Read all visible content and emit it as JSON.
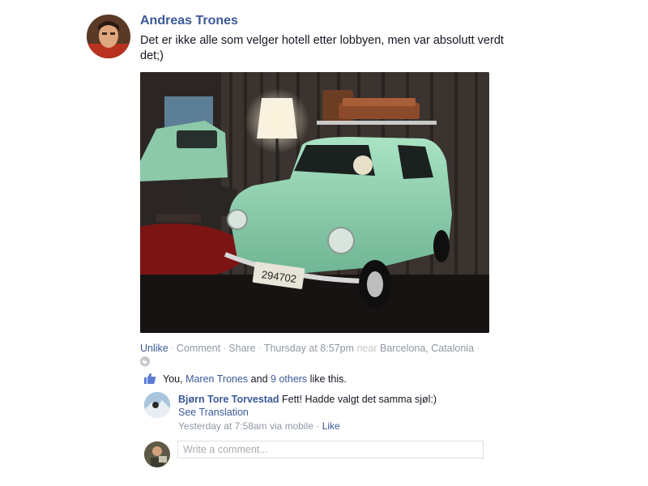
{
  "post": {
    "author": "Andreas Trones",
    "text": "Det er ikke alle som velger hotell etter lobbyen, men var absolutt verdt det;)",
    "photo_plate": "294702"
  },
  "actions": {
    "unlike": "Unlike",
    "comment": "Comment",
    "share": "Share",
    "timestamp": "Thursday at 8:57pm",
    "near": "near",
    "location": "Barcelona, Catalonia",
    "separator": "·"
  },
  "likes": {
    "prefix": "You,",
    "person": "Maren Trones",
    "and": "and",
    "others": "9 others",
    "suffix": "like this."
  },
  "comment": {
    "author": "Bjørn Tore Torvestad",
    "text": "Fett! Hadde valgt det samma sjøl:)",
    "see_translation": "See Translation",
    "meta": "Yesterday at 7:58am via mobile",
    "like": "Like"
  },
  "composer": {
    "placeholder": "Write a comment..."
  },
  "colors": {
    "link": "#3b5998",
    "muted": "#9197a3",
    "car": "#9ad6b6"
  }
}
